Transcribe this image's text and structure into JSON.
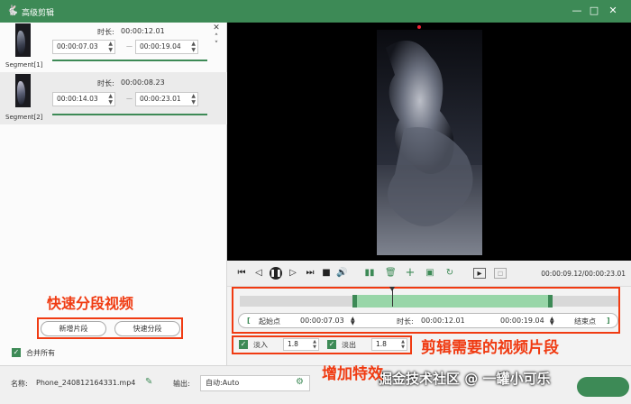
{
  "window": {
    "title": "高级剪辑",
    "app_icon": "app-logo-icon"
  },
  "segments": [
    {
      "label": "Segment[1]",
      "duration_label": "时长:",
      "duration": "00:00:12.01",
      "start": "00:00:07.03",
      "end": "00:00:19.04",
      "progress_fraction": 1.0
    },
    {
      "label": "Segment[2]",
      "duration_label": "时长:",
      "duration": "00:00:08.23",
      "start": "00:00:14.03",
      "end": "00:00:23.01",
      "progress_fraction": 1.0
    }
  ],
  "left_buttons": {
    "new_segment": "新增片段",
    "quick_split": "快速分段"
  },
  "merge_all": {
    "label": "合并所有",
    "checked": true
  },
  "annotations": {
    "quick_split_video": "快速分段视频",
    "trim_needed_clip": "剪辑需要的视频片段",
    "add_effects": "增加特效"
  },
  "controls": {
    "time_readout": "00:00:09.12/00:00:23.01",
    "icons": [
      "skip-start-icon",
      "prev-frame-icon",
      "pause-icon",
      "next-frame-icon",
      "stop-icon",
      "volume-icon",
      "split-icon",
      "delete-icon",
      "add-icon",
      "copy-icon",
      "reset-icon",
      "mark-in-icon",
      "mark-out-icon"
    ]
  },
  "timeline": {
    "selection_start_fraction": 0.297,
    "selection_end_fraction": 0.826,
    "playhead_fraction": 0.4
  },
  "range": {
    "start_label": "起始点",
    "start": "00:00:07.03",
    "duration_label": "时长:",
    "duration": "00:00:12.01",
    "end": "00:00:19.04",
    "end_label": "结束点",
    "open_bracket": "[",
    "close_bracket": "]"
  },
  "fade": {
    "fade_in_label": "淡入",
    "fade_in_value": "1.8",
    "fade_in_checked": true,
    "fade_out_label": "淡出",
    "fade_out_value": "1.8",
    "fade_out_checked": true
  },
  "bottom": {
    "name_label": "名称:",
    "filename": "Phone_240812164331.mp4",
    "output_label": "输出:",
    "output_value": "自动:Auto"
  },
  "watermark": "掘金技术社区 @ 一罐小可乐",
  "colors": {
    "accent": "#3d8a56",
    "annotation": "#f03b12",
    "selection": "#98d6a8"
  }
}
